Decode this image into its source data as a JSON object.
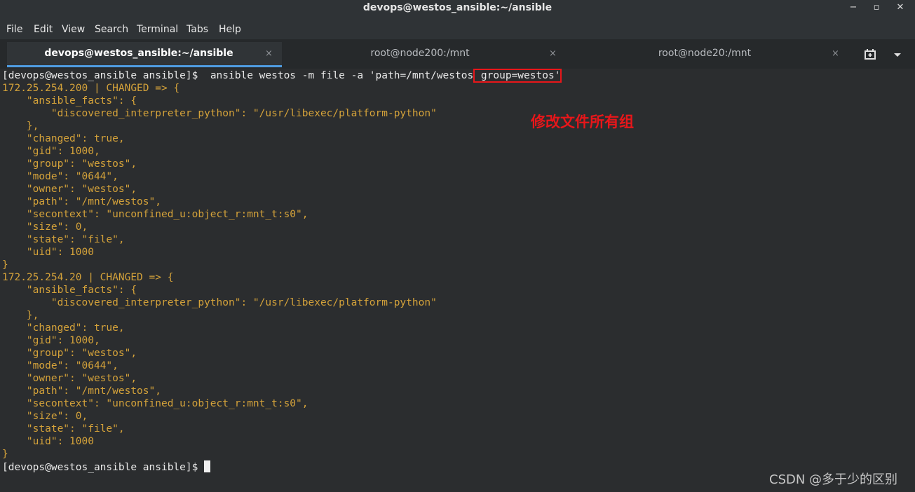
{
  "window": {
    "title": "devops@westos_ansible:~/ansible",
    "controls": {
      "minimize": "−",
      "maximize": "▫",
      "close": "✕"
    }
  },
  "menu": [
    "File",
    "Edit",
    "View",
    "Search",
    "Terminal",
    "Tabs",
    "Help"
  ],
  "tabs": [
    {
      "label": "devops@westos_ansible:~/ansible",
      "close": "×",
      "active": true
    },
    {
      "label": "root@node200:/mnt",
      "close": "×",
      "active": false
    },
    {
      "label": "root@node20:/mnt",
      "close": "×",
      "active": false
    }
  ],
  "terminal": {
    "command_prompt": "[devops@westos_ansible ansible]$ ",
    "command_main": " ansible westos -m file -a 'path=/mnt/westos",
    "command_highlight": " group=westos'",
    "output_lines": [
      "172.25.254.200 | CHANGED => {",
      "    \"ansible_facts\": {",
      "        \"discovered_interpreter_python\": \"/usr/libexec/platform-python\"",
      "    },",
      "    \"changed\": true,",
      "    \"gid\": 1000,",
      "    \"group\": \"westos\",",
      "    \"mode\": \"0644\",",
      "    \"owner\": \"westos\",",
      "    \"path\": \"/mnt/westos\",",
      "    \"secontext\": \"unconfined_u:object_r:mnt_t:s0\",",
      "    \"size\": 0,",
      "    \"state\": \"file\",",
      "    \"uid\": 1000",
      "}",
      "172.25.254.20 | CHANGED => {",
      "    \"ansible_facts\": {",
      "        \"discovered_interpreter_python\": \"/usr/libexec/platform-python\"",
      "    },",
      "    \"changed\": true,",
      "    \"gid\": 1000,",
      "    \"group\": \"westos\",",
      "    \"mode\": \"0644\",",
      "    \"owner\": \"westos\",",
      "    \"path\": \"/mnt/westos\",",
      "    \"secontext\": \"unconfined_u:object_r:mnt_t:s0\",",
      "    \"size\": 0,",
      "    \"state\": \"file\",",
      "    \"uid\": 1000",
      "}"
    ],
    "final_prompt": "[devops@westos_ansible ansible]$ "
  },
  "annotation": "修改文件所有组",
  "watermark": "CSDN @多于少的区别",
  "colors": {
    "output_text": "#d4a23a",
    "prompt_text": "#e9e9e9",
    "annotation": "#e8161a",
    "highlight_box": "#e8161a",
    "active_tab_underline": "#4f9de2",
    "terminal_bg": "#2b2d2f"
  }
}
